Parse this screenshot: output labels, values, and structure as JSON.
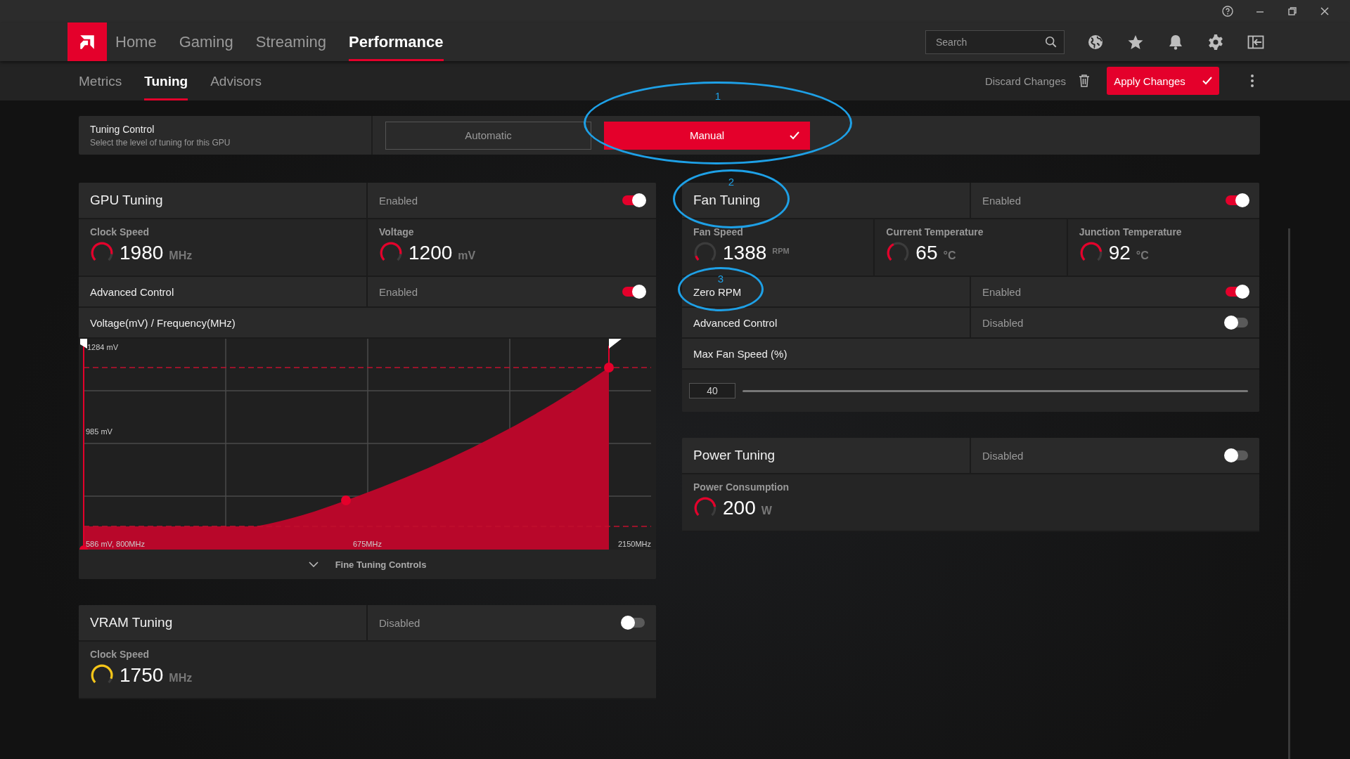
{
  "nav": {
    "tabs": [
      {
        "label": "Home",
        "selected": false
      },
      {
        "label": "Gaming",
        "selected": false
      },
      {
        "label": "Streaming",
        "selected": false
      },
      {
        "label": "Performance",
        "selected": true
      }
    ],
    "search": {
      "placeholder": "Search"
    }
  },
  "subnav": {
    "tabs": [
      {
        "label": "Metrics",
        "selected": false
      },
      {
        "label": "Tuning",
        "selected": true
      },
      {
        "label": "Advisors",
        "selected": false
      }
    ],
    "discard": "Discard Changes",
    "apply": "Apply Changes"
  },
  "tuning_control": {
    "title": "Tuning Control",
    "subtitle": "Select the level of tuning for this GPU",
    "options": [
      {
        "label": "Automatic",
        "selected": false
      },
      {
        "label": "Manual",
        "selected": true
      }
    ]
  },
  "left_column": [
    {
      "title": "GPU Tuning",
      "status": "Enabled",
      "on": true,
      "metrics": [
        {
          "label": "Clock Speed",
          "value": "1980",
          "unit": "MHz",
          "level": 0.85,
          "color": "#e4002b"
        },
        {
          "label": "Voltage",
          "value": "1200",
          "unit": "mV",
          "level": 0.85,
          "color": "#e4002b"
        }
      ],
      "rows": [
        {
          "kind": "toggle",
          "label": "Advanced Control",
          "status": "Enabled",
          "on": true
        },
        {
          "kind": "heading",
          "label": "Voltage(mV) / Frequency(MHz)"
        },
        {
          "kind": "curve",
          "y_top": "1284 mV",
          "y_mid": "985 mV",
          "x_left": "586 mV, 800MHz",
          "x_mid": "675MHz",
          "x_right": "2150MHz"
        },
        {
          "kind": "expander",
          "label": "Fine Tuning Controls"
        }
      ]
    },
    {
      "title": "VRAM Tuning",
      "status": "Disabled",
      "on": false,
      "metrics": [
        {
          "label": "Clock Speed",
          "value": "1750",
          "unit": "MHz",
          "level": 0.9,
          "color": "#f5c518"
        }
      ]
    }
  ],
  "right_column": [
    {
      "title": "Fan Tuning",
      "status": "Enabled",
      "on": true,
      "metrics": [
        {
          "label": "Fan Speed",
          "value": "1388",
          "unit": "RPM",
          "level": 0.1,
          "color": "#e4002b"
        },
        {
          "label": "Current Temperature",
          "value": "65",
          "unit": "°C",
          "level": 0.4,
          "color": "#e4002b"
        },
        {
          "label": "Junction Temperature",
          "value": "92",
          "unit": "°C",
          "level": 0.8,
          "color": "#e4002b"
        }
      ],
      "rows": [
        {
          "kind": "toggle",
          "label": "Zero RPM",
          "status": "Enabled",
          "on": true
        },
        {
          "kind": "toggle",
          "label": "Advanced Control",
          "status": "Disabled",
          "on": false
        },
        {
          "kind": "heading",
          "label": "Max Fan Speed (%)"
        },
        {
          "kind": "slider",
          "value": "40"
        }
      ]
    },
    {
      "title": "Power Tuning",
      "status": "Disabled",
      "on": false,
      "metrics": [
        {
          "label": "Power Consumption",
          "value": "200",
          "unit": "W",
          "level": 0.8,
          "color": "#e4002b"
        }
      ]
    }
  ],
  "annotations": [
    {
      "label": "1"
    },
    {
      "label": "2"
    },
    {
      "label": "3"
    }
  ]
}
